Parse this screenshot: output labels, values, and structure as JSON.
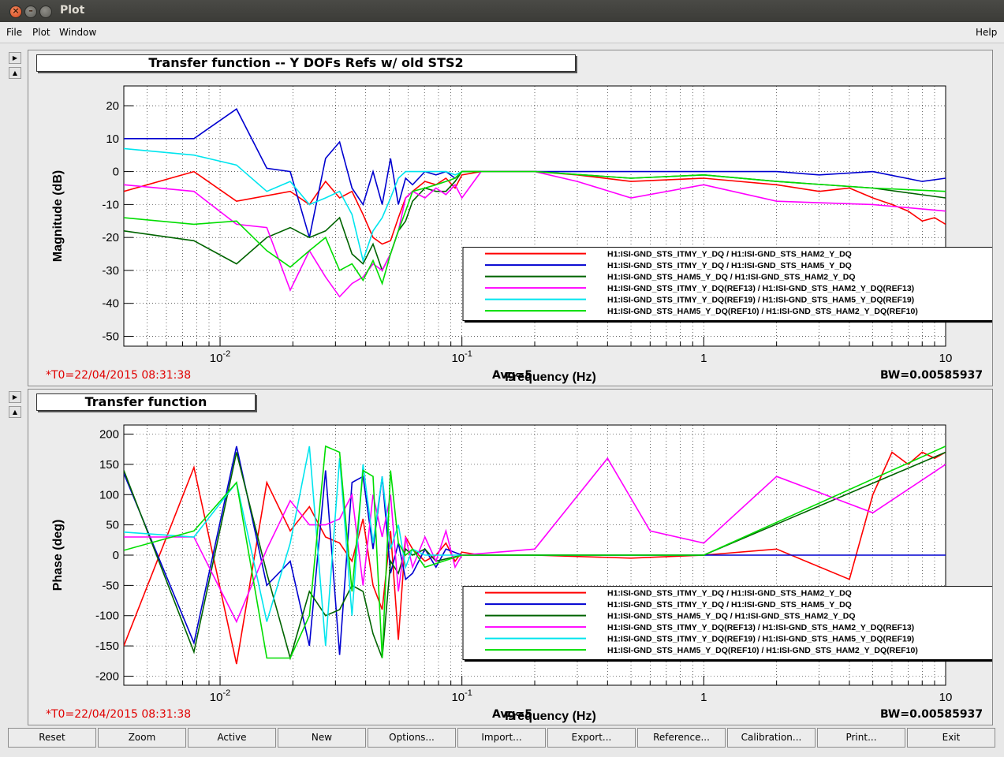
{
  "window": {
    "title": "Plot",
    "close_glyph": "×",
    "min_glyph": "–"
  },
  "menu": {
    "file": "File",
    "plot": "Plot",
    "window": "Window",
    "help": "Help"
  },
  "side_buttons": {
    "right_arrow": "▶",
    "up_arrow": "▲"
  },
  "top_panel": {
    "title": "Transfer function -- Y DOFs Refs w/ old STS2",
    "t0": "*T0=22/04/2015 08:31:38",
    "avg": "Avg=5",
    "bw": "BW=0.00585937"
  },
  "bottom_panel": {
    "title": "Transfer function",
    "t0": "*T0=22/04/2015 08:31:38",
    "avg": "Avg=5",
    "bw": "BW=0.00585937"
  },
  "buttons": [
    "Reset",
    "Zoom",
    "Active",
    "New",
    "Options...",
    "Import...",
    "Export...",
    "Reference...",
    "Calibration...",
    "Print...",
    "Exit"
  ],
  "colors": {
    "red": "#ff0000",
    "blue": "#0000d0",
    "darkgreen": "#006400",
    "magenta": "#ff00ff",
    "cyan": "#00e5ee",
    "green": "#00dd00",
    "error_text": "#e00000"
  },
  "chart_data": [
    {
      "type": "line",
      "xlabel": "Frequency (Hz)",
      "ylabel": "Magnitude (dB)",
      "xscale": "log",
      "xlim": [
        0.004,
        10
      ],
      "ylim": [
        -53,
        26
      ],
      "x_ticks": [
        "10",
        "1",
        "10",
        "10"
      ],
      "x_tick_exponents": [
        "-2",
        "",
        "-1",
        ""
      ],
      "x_tick_labels": [
        "10^-2",
        "10^-1",
        "1",
        "10"
      ],
      "y_ticks": [
        20,
        10,
        0,
        -10,
        -20,
        -30,
        -40,
        -50
      ],
      "grid": true,
      "legend_position": "bottom-right",
      "series": [
        {
          "name": "H1:ISI-GND_STS_ITMY_Y_DQ / H1:ISI-GND_STS_HAM2_Y_DQ",
          "color": "#ff0000",
          "x": [
            0.004,
            0.0078,
            0.0117,
            0.0195,
            0.0234,
            0.0273,
            0.0312,
            0.0351,
            0.039,
            0.0429,
            0.0468,
            0.0507,
            0.0546,
            0.0585,
            0.0625,
            0.0703,
            0.0781,
            0.0859,
            0.0937,
            0.1,
            0.12,
            0.15,
            0.2,
            0.3,
            0.5,
            1,
            2,
            3,
            4,
            5,
            6,
            7,
            8,
            9,
            10
          ],
          "y": [
            -6,
            0,
            -9,
            -6,
            -10,
            -3,
            -8,
            -6,
            -13,
            -20,
            -22,
            -21,
            -14,
            -8,
            -6,
            -3,
            -4,
            -2,
            -5,
            -1,
            0,
            0,
            0,
            -1,
            -3,
            -2,
            -4,
            -6,
            -5,
            -8,
            -10,
            -12,
            -15,
            -14,
            -16
          ]
        },
        {
          "name": "H1:ISI-GND_STS_ITMY_Y_DQ / H1:ISI-GND_STS_HAM5_Y_DQ",
          "color": "#0000d0",
          "x": [
            0.004,
            0.0078,
            0.0117,
            0.0156,
            0.0195,
            0.0234,
            0.0273,
            0.0312,
            0.0351,
            0.039,
            0.0429,
            0.0468,
            0.0507,
            0.0546,
            0.0585,
            0.0625,
            0.0703,
            0.0781,
            0.0859,
            0.0937,
            0.1,
            0.12,
            0.2,
            0.5,
            1,
            2,
            3,
            5,
            8,
            10
          ],
          "y": [
            10,
            10,
            19,
            1,
            0,
            -20,
            4,
            9,
            -5,
            -10,
            0,
            -10,
            4,
            -10,
            -2,
            -4,
            0,
            -1,
            0,
            -2,
            0,
            0,
            0,
            0,
            0,
            0,
            -1,
            0,
            -3,
            -2
          ]
        },
        {
          "name": "H1:ISI-GND_STS_HAM5_Y_DQ / H1:ISI-GND_STS_HAM2_Y_DQ",
          "color": "#006400",
          "x": [
            0.004,
            0.0078,
            0.0117,
            0.0156,
            0.0195,
            0.0234,
            0.0273,
            0.0312,
            0.0351,
            0.039,
            0.0429,
            0.0468,
            0.0507,
            0.0546,
            0.0585,
            0.0625,
            0.0703,
            0.0781,
            0.0859,
            0.0937,
            0.1,
            0.12,
            0.2,
            0.5,
            1,
            2,
            5,
            10
          ],
          "y": [
            -18,
            -21,
            -28,
            -20,
            -17,
            -20,
            -18,
            -14,
            -25,
            -28,
            -22,
            -30,
            -25,
            -18,
            -15,
            -9,
            -5,
            -6,
            -6,
            -3,
            0,
            0,
            0,
            -2,
            -1,
            -3,
            -5,
            -8
          ]
        },
        {
          "name": "H1:ISI-GND_STS_ITMY_Y_DQ(REF13) / H1:ISI-GND_STS_HAM2_Y_DQ(REF13)",
          "color": "#ff00ff",
          "x": [
            0.004,
            0.0078,
            0.0117,
            0.0156,
            0.0195,
            0.0234,
            0.0273,
            0.0312,
            0.0351,
            0.039,
            0.0429,
            0.0468,
            0.0507,
            0.0546,
            0.0585,
            0.0625,
            0.0703,
            0.0781,
            0.0859,
            0.0937,
            0.1,
            0.12,
            0.2,
            0.3,
            0.5,
            1,
            2,
            5,
            10
          ],
          "y": [
            -4,
            -6,
            -16,
            -17,
            -36,
            -24,
            -32,
            -38,
            -34,
            -32,
            -28,
            -30,
            -25,
            -18,
            -8,
            -6,
            -8,
            -5,
            -7,
            -4,
            -8,
            0,
            0,
            -3,
            -8,
            -4,
            -9,
            -10,
            -12
          ]
        },
        {
          "name": "H1:ISI-GND_STS_ITMY_Y_DQ(REF19) / H1:ISI-GND_STS_HAM5_Y_DQ(REF19)",
          "color": "#00e5ee",
          "x": [
            0.004,
            0.0078,
            0.0117,
            0.0156,
            0.0195,
            0.0234,
            0.0273,
            0.0312,
            0.0351,
            0.039,
            0.0429,
            0.0468,
            0.0507,
            0.0546,
            0.0585,
            0.0625,
            0.0703,
            0.0781,
            0.0859,
            0.0937,
            0.1
          ],
          "y": [
            7,
            5,
            2,
            -6,
            -3,
            -10,
            -8,
            -6,
            -13,
            -27,
            -18,
            -14,
            -8,
            -2,
            0,
            0,
            0,
            0,
            0,
            -1,
            0
          ]
        },
        {
          "name": "H1:ISI-GND_STS_HAM5_Y_DQ(REF10) / H1:ISI-GND_STS_HAM2_Y_DQ(REF10)",
          "color": "#00dd00",
          "x": [
            0.004,
            0.0078,
            0.0117,
            0.0156,
            0.0195,
            0.0234,
            0.0273,
            0.0312,
            0.0351,
            0.039,
            0.0429,
            0.0468,
            0.0507,
            0.0546,
            0.0585,
            0.0625,
            0.0703,
            0.0781,
            0.0859,
            0.0937,
            0.1,
            0.12,
            0.2,
            0.5,
            1,
            2,
            5,
            10
          ],
          "y": [
            -14,
            -16,
            -15,
            -24,
            -29,
            -24,
            -20,
            -30,
            -28,
            -33,
            -27,
            -34,
            -25,
            -18,
            -12,
            -6,
            -5,
            -4,
            -3,
            -2,
            0,
            0,
            0,
            -2,
            -1,
            -3,
            -5,
            -6
          ]
        }
      ]
    },
    {
      "type": "line",
      "xlabel": "Frequency (Hz)",
      "ylabel": "Phase (deg)",
      "xscale": "log",
      "xlim": [
        0.004,
        10
      ],
      "ylim": [
        -215,
        215
      ],
      "x_tick_labels": [
        "10^-2",
        "10^-1",
        "1",
        "10"
      ],
      "y_ticks": [
        200,
        150,
        100,
        50,
        0,
        -50,
        -100,
        -150,
        -200
      ],
      "grid": true,
      "legend_position": "bottom-right",
      "series": [
        {
          "name": "H1:ISI-GND_STS_ITMY_Y_DQ / H1:ISI-GND_STS_HAM2_Y_DQ",
          "color": "#ff0000",
          "x": [
            0.004,
            0.0078,
            0.0117,
            0.0156,
            0.0195,
            0.0234,
            0.0273,
            0.0312,
            0.0351,
            0.039,
            0.0429,
            0.0468,
            0.0507,
            0.0546,
            0.0585,
            0.0625,
            0.0703,
            0.0781,
            0.0859,
            0.0937,
            0.1,
            0.12,
            0.2,
            0.5,
            1,
            2,
            4,
            5,
            6,
            7,
            8,
            9,
            10
          ],
          "y": [
            -150,
            145,
            -180,
            120,
            40,
            80,
            30,
            20,
            -10,
            60,
            -50,
            -90,
            40,
            -140,
            30,
            10,
            -10,
            0,
            20,
            -10,
            5,
            0,
            0,
            -5,
            0,
            10,
            -40,
            100,
            170,
            150,
            170,
            160,
            170
          ]
        },
        {
          "name": "H1:ISI-GND_STS_ITMY_Y_DQ / H1:ISI-GND_STS_HAM5_Y_DQ",
          "color": "#0000d0",
          "x": [
            0.004,
            0.0078,
            0.0117,
            0.0156,
            0.0195,
            0.0234,
            0.0273,
            0.0312,
            0.0351,
            0.039,
            0.0429,
            0.0468,
            0.0507,
            0.0546,
            0.0585,
            0.0625,
            0.0703,
            0.0781,
            0.0859,
            0.1,
            0.2,
            0.5,
            1,
            2,
            5,
            10
          ],
          "y": [
            135,
            -145,
            180,
            -50,
            -10,
            -150,
            140,
            -165,
            120,
            130,
            10,
            130,
            -30,
            20,
            -40,
            -30,
            10,
            -20,
            10,
            0,
            0,
            0,
            0,
            0,
            0,
            0
          ]
        },
        {
          "name": "H1:ISI-GND_STS_HAM5_Y_DQ / H1:ISI-GND_STS_HAM2_Y_DQ",
          "color": "#006400",
          "x": [
            0.004,
            0.0078,
            0.0117,
            0.0156,
            0.0195,
            0.0234,
            0.0273,
            0.0312,
            0.0351,
            0.039,
            0.0429,
            0.0468,
            0.0507,
            0.0546,
            0.0585,
            0.0625,
            0.0703,
            0.0781,
            0.1,
            0.2,
            1,
            10
          ],
          "y": [
            140,
            -160,
            170,
            -30,
            -170,
            -60,
            -100,
            -90,
            -50,
            -60,
            -130,
            -170,
            -10,
            -30,
            10,
            0,
            10,
            -10,
            0,
            0,
            0,
            170
          ]
        },
        {
          "name": "H1:ISI-GND_STS_ITMY_Y_DQ(REF13) / H1:ISI-GND_STS_HAM2_Y_DQ(REF13)",
          "color": "#ff00ff",
          "x": [
            0.004,
            0.0078,
            0.0117,
            0.0156,
            0.0195,
            0.0234,
            0.0273,
            0.0312,
            0.0351,
            0.039,
            0.0429,
            0.0468,
            0.0507,
            0.0546,
            0.0585,
            0.0625,
            0.0703,
            0.0781,
            0.0859,
            0.0937,
            0.1,
            0.2,
            0.4,
            0.6,
            1,
            2,
            5,
            10
          ],
          "y": [
            30,
            30,
            -110,
            10,
            90,
            50,
            50,
            60,
            100,
            -50,
            100,
            30,
            100,
            -60,
            30,
            -20,
            30,
            -10,
            40,
            -20,
            0,
            10,
            160,
            40,
            20,
            130,
            70,
            150
          ]
        },
        {
          "name": "H1:ISI-GND_STS_ITMY_Y_DQ(REF19) / H1:ISI-GND_STS_HAM5_Y_DQ(REF19)",
          "color": "#00e5ee",
          "x": [
            0.004,
            0.0078,
            0.0117,
            0.0156,
            0.0195,
            0.0234,
            0.0273,
            0.0312,
            0.0351,
            0.039,
            0.0429,
            0.0468,
            0.0507,
            0.0546,
            0.0585,
            0.0625,
            0.0703,
            0.1
          ],
          "y": [
            38,
            30,
            120,
            -110,
            20,
            180,
            -150,
            160,
            -100,
            150,
            20,
            130,
            10,
            50,
            -20,
            10,
            0,
            0
          ]
        },
        {
          "name": "H1:ISI-GND_STS_HAM5_Y_DQ(REF10) / H1:ISI-GND_STS_HAM2_Y_DQ(REF10)",
          "color": "#00dd00",
          "x": [
            0.004,
            0.0078,
            0.0117,
            0.0156,
            0.0195,
            0.0234,
            0.0273,
            0.0312,
            0.0351,
            0.039,
            0.0429,
            0.0468,
            0.0507,
            0.0546,
            0.0585,
            0.0625,
            0.0703,
            0.1,
            1,
            10
          ],
          "y": [
            8,
            40,
            120,
            -170,
            -170,
            -100,
            180,
            170,
            -60,
            140,
            130,
            -170,
            140,
            20,
            0,
            10,
            -20,
            0,
            0,
            180
          ]
        }
      ]
    }
  ]
}
